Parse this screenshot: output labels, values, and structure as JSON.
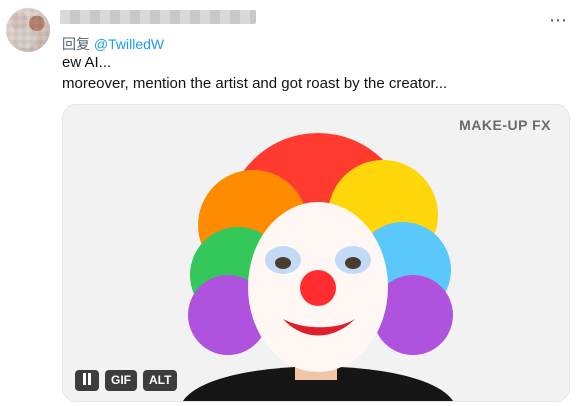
{
  "tweet": {
    "reply_prefix": "回复",
    "mention": "@TwilledW",
    "line1": "ew AI...",
    "line2": "moreover, mention the artist and got roast by the creator...",
    "more_icon": "more-icon"
  },
  "media": {
    "watermark": "MAKE-UP FX",
    "controls": {
      "pause_label": "",
      "gif_label": "GIF",
      "alt_label": "ALT"
    }
  }
}
